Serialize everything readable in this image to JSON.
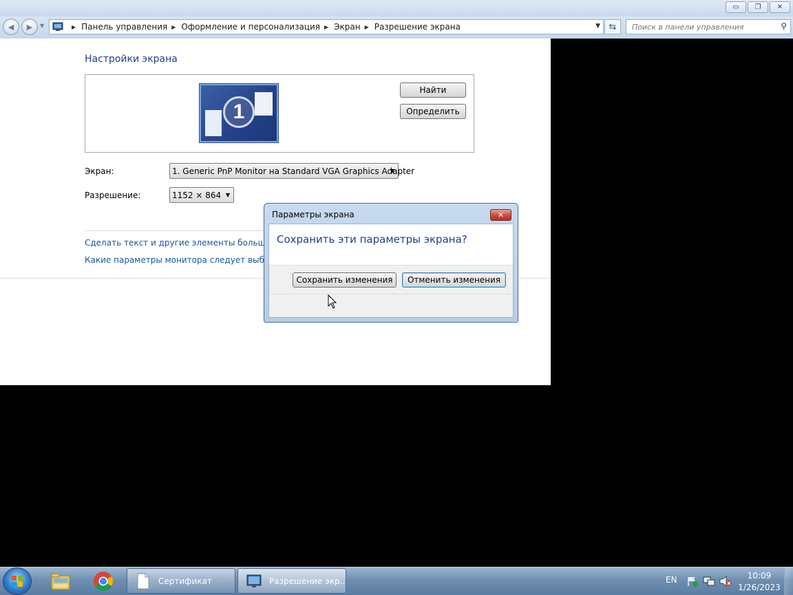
{
  "titlebar": {
    "minimize_icon": "minimize-icon",
    "maximize_icon": "restore-icon",
    "close_icon": "close-icon"
  },
  "navigation": {
    "back_icon": "back-arrow-icon",
    "forward_icon": "forward-arrow-icon",
    "breadcrumb": [
      "Панель управления",
      "Оформление и персонализация",
      "Экран",
      "Разрешение экрана"
    ],
    "search_placeholder": "Поиск в панели управления"
  },
  "main": {
    "title": "Настройки экрана",
    "monitor_number": "1",
    "find_button": "Найти",
    "identify_button": "Определить",
    "display_label": "Экран:",
    "display_value": "1. Generic PnP Monitor на Standard VGA Graphics Adapter",
    "resolution_label": "Разрешение:",
    "resolution_value": "1152 × 864",
    "links": [
      "Сделать текст и другие элементы больше или м",
      "Какие параметры монитора следует выбрать?"
    ]
  },
  "dialog": {
    "title": "Параметры экрана",
    "question": "Сохранить эти параметры экрана?",
    "save_button": "Сохранить изменения",
    "cancel_button": "Отменить изменения",
    "close_icon": "close-icon"
  },
  "taskbar": {
    "tasks": [
      "Сертификат",
      "Разрешение экр..."
    ],
    "language": "EN",
    "time": "10:09",
    "date": "1/26/2023"
  }
}
